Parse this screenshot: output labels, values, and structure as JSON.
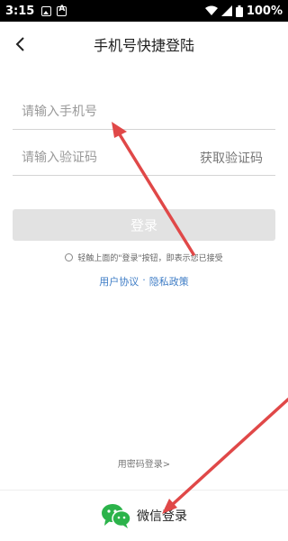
{
  "status_bar": {
    "time": "3:15",
    "battery": "100%"
  },
  "header": {
    "title": "手机号快捷登陆",
    "back_icon": "chevron-left-icon"
  },
  "form": {
    "phone_placeholder": "请输入手机号",
    "code_placeholder": "请输入验证码",
    "get_code_label": "获取验证码",
    "login_label": "登录"
  },
  "agreement": {
    "text": "轻触上面的\"登录\"按钮，即表示您已接受",
    "user_agreement": "用户协议",
    "separator": "·",
    "privacy_policy": "隐私政策"
  },
  "alt_login": {
    "password_login": "用密码登录>",
    "wechat_label": "微信登录",
    "wechat_icon": "wechat-icon"
  },
  "colors": {
    "link": "#3f7dc6",
    "wechat_green": "#2bb34a",
    "login_disabled_bg": "#e2e2e2",
    "annotation_arrow": "#e04848"
  }
}
